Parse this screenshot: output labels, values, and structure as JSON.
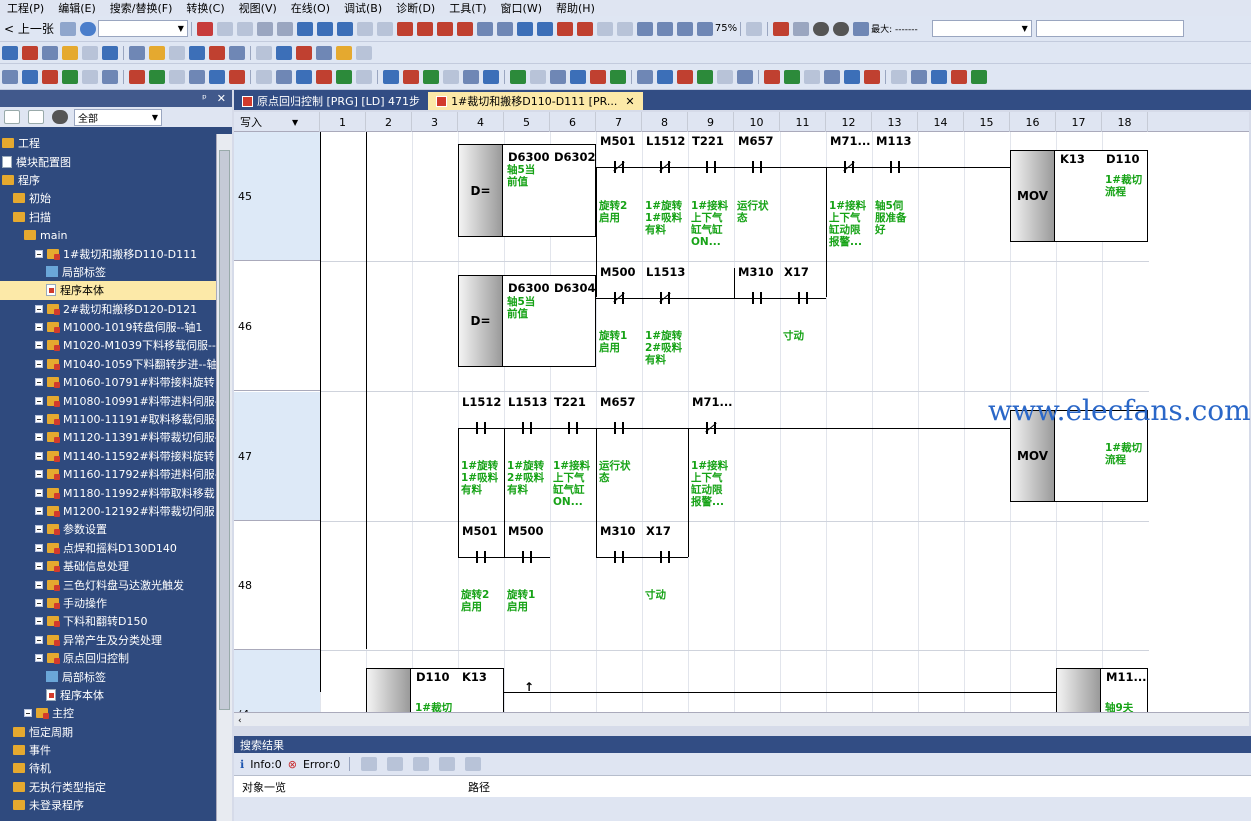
{
  "menu": [
    "工程(P)",
    "编辑(E)",
    "搜索/替换(F)",
    "转换(C)",
    "视图(V)",
    "在线(O)",
    "调试(B)",
    "诊断(D)",
    "工具(T)",
    "窗口(W)",
    "帮助(H)"
  ],
  "toolbar": {
    "back_label": "< 上一张",
    "zoom": "75%",
    "max_label": "最大: -------"
  },
  "left_panel": {
    "filter": "全部",
    "tree": [
      {
        "label": "工程",
        "type": "plain",
        "indent": 0
      },
      {
        "label": "模块配置图",
        "type": "doc",
        "indent": 0
      },
      {
        "label": "程序",
        "type": "plain",
        "indent": 0
      },
      {
        "label": "初始",
        "type": "fold",
        "indent": 1
      },
      {
        "label": "扫描",
        "type": "fold",
        "indent": 1
      },
      {
        "label": "main",
        "type": "fold",
        "indent": 2
      },
      {
        "label": "1#裁切和搬移D110-D111",
        "type": "foldred",
        "indent": 3
      },
      {
        "label": "局部标签",
        "type": "lbl",
        "indent": 4
      },
      {
        "label": "程序本体",
        "type": "docred",
        "indent": 4,
        "selected": true
      },
      {
        "label": "2#裁切和搬移D120-D121",
        "type": "foldred",
        "indent": 3
      },
      {
        "label": "M1000-1019转盘伺服--轴1",
        "type": "foldred",
        "indent": 3
      },
      {
        "label": "M1020-M1039下料移载伺服--",
        "type": "foldred",
        "indent": 3
      },
      {
        "label": "M1040-1059下料翻转步进--轴",
        "type": "foldred",
        "indent": 3
      },
      {
        "label": "M1060-10791#料带接料旋转",
        "type": "foldred",
        "indent": 3
      },
      {
        "label": "M1080-10991#料带进料伺服-",
        "type": "foldred",
        "indent": 3
      },
      {
        "label": "M1100-11191#取料移载伺服-",
        "type": "foldred",
        "indent": 3
      },
      {
        "label": "M1120-11391#料带裁切伺服-",
        "type": "foldred",
        "indent": 3
      },
      {
        "label": "M1140-11592#料带接料旋转",
        "type": "foldred",
        "indent": 3
      },
      {
        "label": "M1160-11792#料带进料伺服-",
        "type": "foldred",
        "indent": 3
      },
      {
        "label": "M1180-11992#料带取料移载",
        "type": "foldred",
        "indent": 3
      },
      {
        "label": "M1200-12192#料带裁切伺服",
        "type": "foldred",
        "indent": 3
      },
      {
        "label": "参数设置",
        "type": "foldred",
        "indent": 3
      },
      {
        "label": "点焊和摇料D130D140",
        "type": "foldred",
        "indent": 3
      },
      {
        "label": "基础信息处理",
        "type": "foldred",
        "indent": 3
      },
      {
        "label": "三色灯料盘马达激光触发",
        "type": "foldred",
        "indent": 3
      },
      {
        "label": "手动操作",
        "type": "foldred",
        "indent": 3
      },
      {
        "label": "下料和翻转D150",
        "type": "foldred",
        "indent": 3
      },
      {
        "label": "异常产生及分类处理",
        "type": "foldred",
        "indent": 3
      },
      {
        "label": "原点回归控制",
        "type": "foldred",
        "indent": 3
      },
      {
        "label": "局部标签",
        "type": "lbl",
        "indent": 4
      },
      {
        "label": "程序本体",
        "type": "docred",
        "indent": 4
      },
      {
        "label": "主控",
        "type": "foldred",
        "indent": 2
      },
      {
        "label": "恒定周期",
        "type": "fold",
        "indent": 1
      },
      {
        "label": "事件",
        "type": "fold",
        "indent": 1
      },
      {
        "label": "待机",
        "type": "fold",
        "indent": 1
      },
      {
        "label": "无执行类型指定",
        "type": "fold",
        "indent": 1
      },
      {
        "label": "未登录程序",
        "type": "fold",
        "indent": 1
      }
    ]
  },
  "tabs": [
    {
      "label": "原点回归控制 [PRG] [LD] 471步",
      "active": false
    },
    {
      "label": "1#裁切和搬移D110-D111 [PR...",
      "active": true
    }
  ],
  "ladder": {
    "write_label": "写入",
    "columns": [
      "1",
      "2",
      "3",
      "4",
      "5",
      "6",
      "7",
      "8",
      "9",
      "10",
      "11",
      "12",
      "13",
      "14",
      "15",
      "16",
      "17",
      "18"
    ],
    "steps": [
      "45",
      "46",
      "47",
      "48",
      "(4"
    ],
    "r45": {
      "cmp_op": "D=",
      "cmp_a": "D6300",
      "cmp_b": "D6302",
      "cmp_cmt": "轴5当\n前值",
      "c7": "M501",
      "c7c": "旋转2\n启用",
      "c8": "L1512",
      "c8c": "1#旋转\n1#吸料\n有料",
      "c9": "T221",
      "c9c": "1#接料\n上下气\n缸气缸\nON...",
      "c10": "M657",
      "c10c": "运行状\n态",
      "c12": "M71...",
      "c12c": "1#接料\n上下气\n缸动限\n报警...",
      "c13": "M113",
      "c13c": "轴5伺\n服准备\n好",
      "mov": "MOV",
      "d1": "K13",
      "d2": "D110",
      "d2c": "1#裁切\n流程"
    },
    "r46": {
      "cmp_op": "D=",
      "cmp_a": "D6300",
      "cmp_b": "D6304",
      "cmp_cmt": "轴5当\n前值",
      "c7": "M500",
      "c7c": "旋转1\n启用",
      "c8": "L1513",
      "c8c": "1#旋转\n2#吸料\n有料",
      "c10": "M310",
      "c11": "X17",
      "c11c": "寸动"
    },
    "r47": {
      "c4": "L1512",
      "c4c": "1#旋转\n1#吸料\n有料",
      "c5": "L1513",
      "c5c": "1#旋转\n2#吸料\n有料",
      "c6": "T221",
      "c6c": "1#接料\n上下气\n缸气缸\nON...",
      "c7": "M657",
      "c7c": "运行状\n态",
      "c9": "M71...",
      "c9c": "1#接料\n上下气\n缸动限\n报警...",
      "mov": "MOV",
      "d2c": "1#裁切\n流程"
    },
    "r48": {
      "c4": "M501",
      "c4c": "旋转2\n启用",
      "c5": "M500",
      "c5c": "旋转1\n启用",
      "c7": "M310",
      "c8": "X17",
      "c8c": "寸动"
    },
    "r49": {
      "a": "D110",
      "b": "K13",
      "cmt": "1#裁切",
      "out": "M11...",
      "outc": "轴9夫"
    }
  },
  "search": {
    "title": "搜索结果",
    "info": "Info:0",
    "error": "Error:0",
    "col1": "对象一览",
    "col2": "路径"
  },
  "watermark": "www.elecfans.com"
}
